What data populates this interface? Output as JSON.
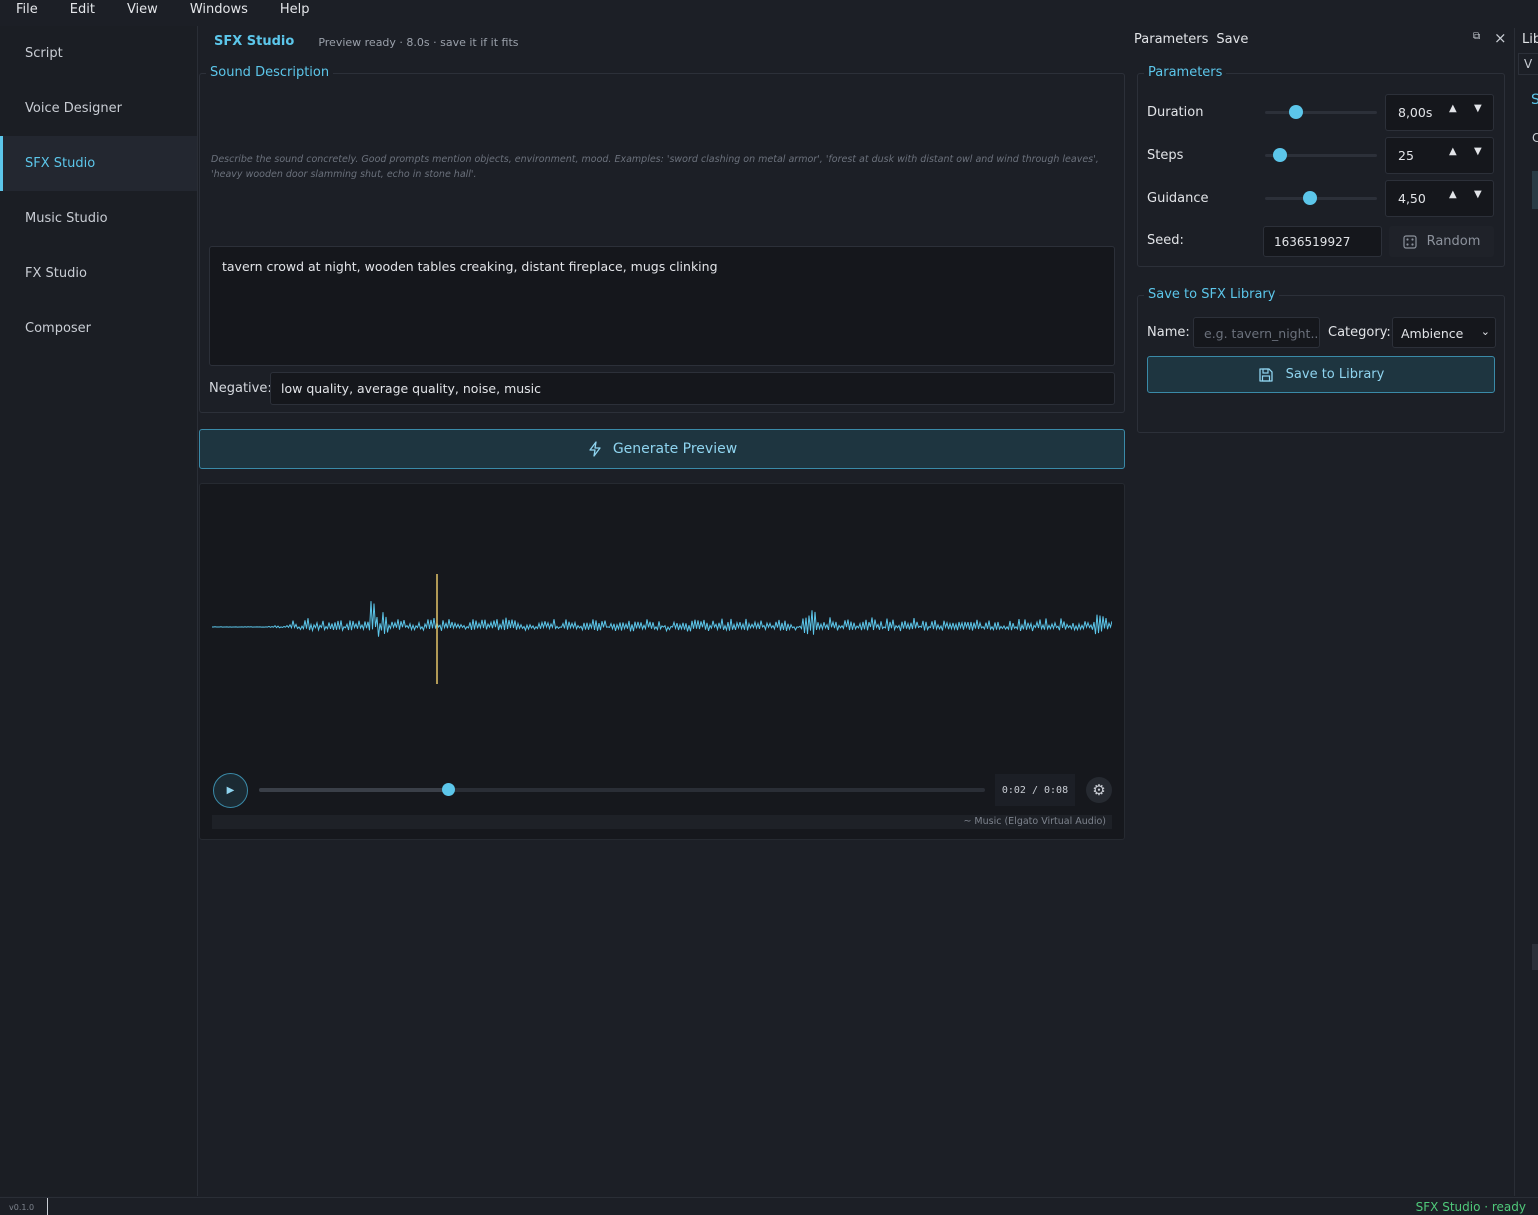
{
  "menu": [
    "File",
    "Edit",
    "View",
    "Windows",
    "Help"
  ],
  "sidebar": {
    "items": [
      {
        "label": "Script",
        "active": false
      },
      {
        "label": "Voice Designer",
        "active": false
      },
      {
        "label": "SFX Studio",
        "active": true
      },
      {
        "label": "Music Studio",
        "active": false
      },
      {
        "label": "FX Studio",
        "active": false
      },
      {
        "label": "Composer",
        "active": false
      }
    ]
  },
  "header": {
    "title": "SFX Studio",
    "status": "Preview ready · 8.0s · save it if it fits"
  },
  "sound_description": {
    "group_title": "Sound Description",
    "hint": "Describe the sound concretely. Good prompts mention objects, environment, mood. Examples: 'sword clashing on metal armor', 'forest at dusk with distant owl and wind through leaves', 'heavy wooden door slamming shut, echo in stone hall'.",
    "prompt": "tavern crowd at night, wooden tables creaking, distant fireplace, mugs clinking",
    "negative_label": "Negative:",
    "negative_value": "low quality, average quality, noise, music"
  },
  "generate_button": {
    "label": "Generate Preview",
    "icon": "lightning-icon"
  },
  "player": {
    "time": "0:02 / 0:08",
    "progress": 0.26,
    "playhead_fraction": 0.25,
    "device": "~ Music (Elgato Virtual Audio)",
    "icons": {
      "play": "play-icon",
      "settings": "gear-icon"
    },
    "colors": {
      "waveform": "#5cc6ea",
      "playhead": "#e3c46a"
    }
  },
  "dock": {
    "tabs": [
      "Parameters",
      "Save"
    ],
    "parameters": {
      "group_title": "Parameters",
      "duration": {
        "label": "Duration",
        "value": "8,00s",
        "fraction": 0.28
      },
      "steps": {
        "label": "Steps",
        "value": "25",
        "fraction": 0.13
      },
      "guidance": {
        "label": "Guidance",
        "value": "4,50",
        "fraction": 0.4
      },
      "seed": {
        "label": "Seed:",
        "value": "1636519927"
      },
      "random_label": "Random"
    },
    "save": {
      "group_title": "Save to SFX Library",
      "name_label": "Name:",
      "name_placeholder": "e.g. tavern_night...",
      "category_label": "Category:",
      "category_value": "Ambience",
      "save_button": "Save to Library"
    }
  },
  "library_edge": {
    "tab": "Lib",
    "v": "V",
    "s": "S",
    "c": "C"
  },
  "statusbar": {
    "version": "v0.1.0",
    "status": "SFX Studio · ready"
  },
  "colors": {
    "accent": "#5cc6ea",
    "ready": "#4fc97a",
    "background": "#1c1f26"
  }
}
